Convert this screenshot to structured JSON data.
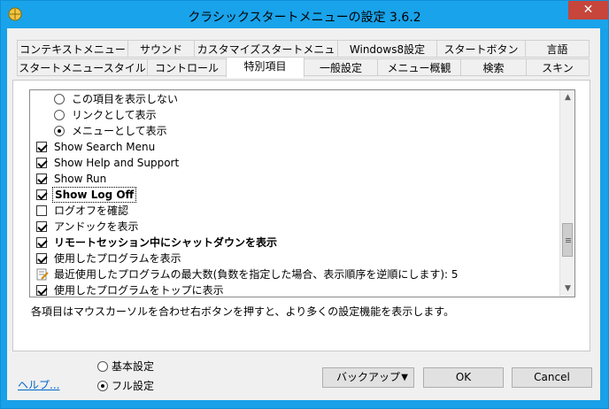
{
  "window": {
    "title": "クラシックスタートメニューの設定 3.6.2",
    "close_glyph": "✕"
  },
  "tabs_row1": [
    {
      "label": "コンテキストメニュー"
    },
    {
      "label": "サウンド"
    },
    {
      "label": "カスタマイズスタートメニュー"
    },
    {
      "label": "Windows8設定"
    },
    {
      "label": "スタートボタン"
    },
    {
      "label": "言語"
    }
  ],
  "tabs_row2": [
    {
      "label": "スタートメニュースタイル"
    },
    {
      "label": "コントロール"
    },
    {
      "label": "特別項目",
      "active": true
    },
    {
      "label": "一般設定"
    },
    {
      "label": "メニュー概観"
    },
    {
      "label": "検索"
    },
    {
      "label": "スキン"
    }
  ],
  "list": {
    "items": [
      {
        "type": "radio",
        "checked": false,
        "label": "この項目を表示しない"
      },
      {
        "type": "radio",
        "checked": false,
        "label": "リンクとして表示"
      },
      {
        "type": "radio",
        "checked": true,
        "label": "メニューとして表示"
      },
      {
        "type": "check",
        "checked": true,
        "label": "Show Search Menu"
      },
      {
        "type": "check",
        "checked": true,
        "label": "Show Help and Support"
      },
      {
        "type": "check",
        "checked": true,
        "label": "Show Run"
      },
      {
        "type": "check",
        "checked": true,
        "label": "Show Log Off",
        "bold": true,
        "focused": true
      },
      {
        "type": "check",
        "checked": false,
        "label": "ログオフを確認"
      },
      {
        "type": "check",
        "checked": true,
        "label": "アンドックを表示"
      },
      {
        "type": "check",
        "checked": true,
        "label": "リモートセッション中にシャットダウンを表示",
        "bold": true
      },
      {
        "type": "check",
        "checked": true,
        "label": "使用したプログラムを表示"
      },
      {
        "type": "edit",
        "label": "最近使用したプログラムの最大数(負数を指定した場合、表示順序を逆順にします): 5"
      },
      {
        "type": "check",
        "checked": true,
        "label": "使用したプログラムをトップに表示"
      }
    ]
  },
  "description": "各項目はマウスカーソルを合わせ右ボタンを押すと、より多くの設定機能を表示します。",
  "footer": {
    "help_link": "ヘルプ...",
    "basic_label": "基本設定",
    "full_label": "フル設定",
    "full_selected": true,
    "backup_label": "バックアップ",
    "ok_label": "OK",
    "cancel_label": "Cancel"
  },
  "icons": {
    "app": "app-icon",
    "edit": "edit-icon",
    "dropdown": "triangle-down-icon"
  }
}
